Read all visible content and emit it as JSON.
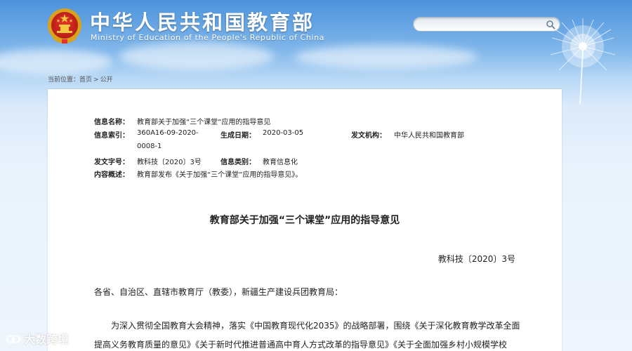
{
  "header": {
    "site_title": "中华人民共和国教育部",
    "site_subtitle": "Ministry of Education of the People's Republic of China",
    "search_placeholder": ""
  },
  "breadcrumb": {
    "prefix": "当前位置：",
    "items": [
      "首页",
      "公开"
    ],
    "separator": ">"
  },
  "meta": {
    "name_label": "信息名称：",
    "name_value": "教育部关于加强“三个课堂”应用的指导意见",
    "index_label": "信息索引：",
    "index_value_line1": "360A16-09-2020-",
    "index_value_line2": "0008-1",
    "date_label": "生成日期：",
    "date_value": "2020-03-05",
    "org_label": "发文机构：",
    "org_value": "中华人民共和国教育部",
    "docno_label": "发文字号：",
    "docno_value": "教科技〔2020〕3号",
    "category_label": "信息类别：",
    "category_value": "教育信息化",
    "summary_label": "内容概述：",
    "summary_value": "教育部发布《关于加强“三个课堂”应用的指导意见》。"
  },
  "document": {
    "title": "教育部关于加强“三个课堂”应用的指导意见",
    "number": "教科技〔2020〕3号",
    "addressee": "各省、自治区、直辖市教育厅（教委），新疆生产建设兵团教育局：",
    "para1_line1": "为深入贯彻全国教育大会精神，落实《中国教育现代化2035》的战略部署，围绕《关于深化教育教学改革全面",
    "para1_line2": "提高义务教育质量的意见》《关于新时代推进普通高中育人方式改革的指导意见》《关于全面加强乡村小规模学校"
  },
  "watermark": {
    "text": "大数跨境"
  },
  "colors": {
    "sky_top": "#4c93dc",
    "sky_bottom": "#eef5fc",
    "panel": "#ffffff",
    "text": "#222222"
  }
}
